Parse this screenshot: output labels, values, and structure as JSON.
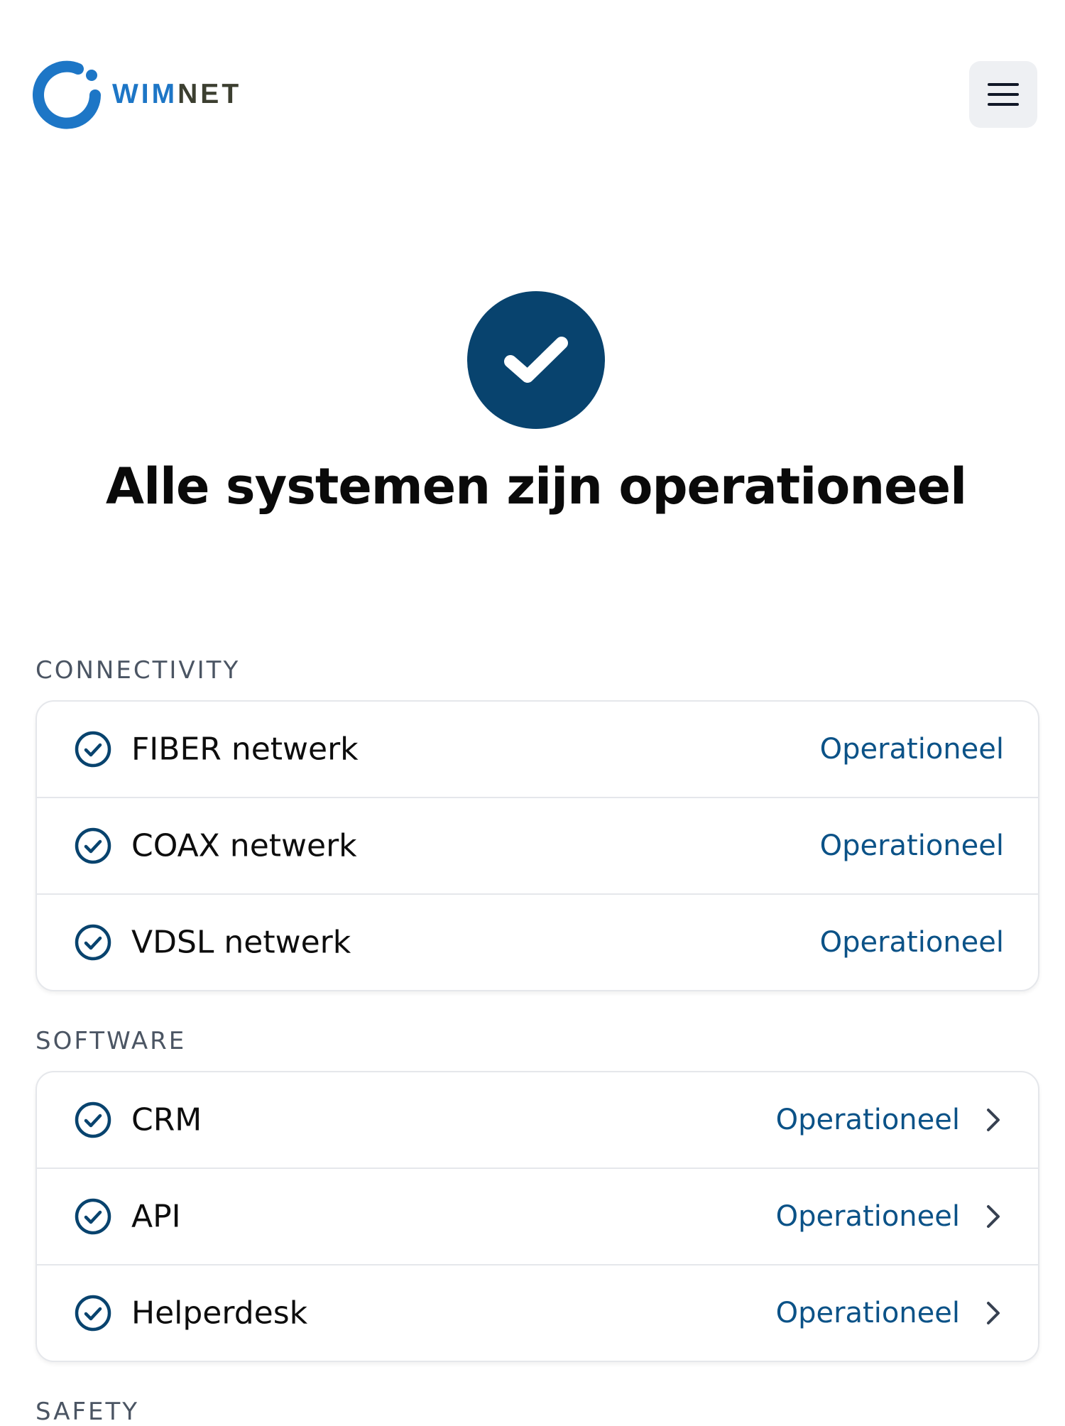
{
  "header": {
    "logo": {
      "part1": "WIM",
      "part2": "NET"
    },
    "menu_icon": "hamburger-menu-icon"
  },
  "hero": {
    "icon": "check-circle-icon",
    "title": "Alle systemen zijn operationeel"
  },
  "sections": [
    {
      "label": "CONNECTIVITY",
      "items": [
        {
          "name": "FIBER netwerk",
          "status": "Operationeel"
        },
        {
          "name": "COAX netwerk",
          "status": "Operationeel"
        },
        {
          "name": "VDSL netwerk",
          "status": "Operationeel"
        }
      ]
    },
    {
      "label": "SOFTWARE",
      "items": [
        {
          "name": "CRM",
          "status": "Operationeel"
        },
        {
          "name": "API",
          "status": "Operationeel"
        },
        {
          "name": "Helperdesk",
          "status": "Operationeel"
        }
      ]
    },
    {
      "label": "SAFETY",
      "items": []
    }
  ],
  "colors": {
    "brand_blue": "#1d76c6",
    "brand_dark": "#3c3f30",
    "status_navy": "#08436e",
    "status_text": "#0b5287",
    "section_label": "#4b5563"
  }
}
